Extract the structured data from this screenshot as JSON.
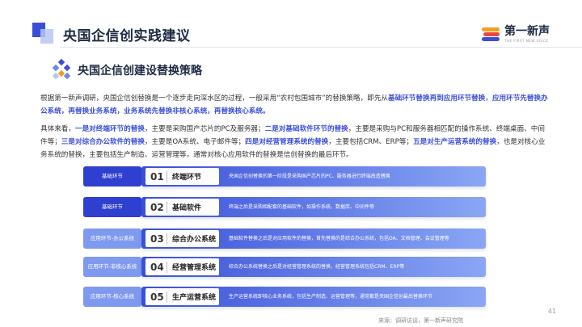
{
  "header": {
    "title": "央国企信创实践建议",
    "logo_text": "第一新声",
    "logo_sub": "THE FIRST NEW VOICE"
  },
  "section": {
    "title": "央国企信创建设替换策略"
  },
  "para1": {
    "t1": "根据第一新声调研，央国企信创替换是一个逐步走向深水区的过程，一般采用“农村包围城市”的替换策略，即先从",
    "h1": "基础环节替换再到应用环节替换",
    "t2": "，",
    "h2": "应用环节先替换办公系统，再替换业务系统，业务系统先替换非核心系统，再替换核心系统。"
  },
  "para2": {
    "t1": "具体来看，",
    "h1": "一是对终端环节的替换",
    "t2": "，主要是采购国产芯片的PC及服务器；",
    "h2": "二是对基础软件环节的替换",
    "t3": "，主要是采购与PC和服务器相匹配的操作系统、终端桌面、中间件等；",
    "h3": "三是对综合办公软件的替换",
    "t4": "，主要是OA系统、电子邮件等；",
    "h4": "四是对经营管理系统的替换",
    "t5": "，主要包括CRM、ERP等；",
    "h5": "五是对生产运营系统的替换",
    "t6": "，也是对核心业务系统的替换，主要包括生产制造、运营管理等，通常对核心应用软件的替换是信创替换的最后环节。"
  },
  "steps": [
    {
      "label": "基础环节",
      "num": "01",
      "name": "终端环节",
      "desc": "央国企信创替换的第一阶段是采购国产芯片的PC、服务器进行终端改造替换"
    },
    {
      "label": "基础环节",
      "num": "02",
      "name": "基础软件",
      "desc": "终端之后是采购相配套的基础软件，如操作系统、数据库、中间件等"
    },
    {
      "label": "应用环节-办公系统",
      "num": "03",
      "name": "综合办公系统",
      "desc": "基础软件替换之后是对应用软件的替换，首先替换的是综合办公系统，包括OA、文档管理、会议管理等"
    },
    {
      "label": "应用环节-非核心系统",
      "num": "04",
      "name": "经营管理系统",
      "desc": "综合办公系统替换之后是对经营管理系统的替换，经营管理系统包括CRM、ERP等"
    },
    {
      "label": "应用环节-核心系统",
      "num": "05",
      "name": "生产运营系统",
      "desc": "生产运营系统即核心业务系统，包括生产制造、运营管理等，通常都是央国企信创最后替换环节"
    }
  ],
  "colors": {
    "label_dark": "#2f3fcf",
    "band_dark": "#3a4fd8",
    "band_light": "#8aa6f4",
    "label_light": "#7f99ef"
  },
  "page_number": "41",
  "source": "来源：调研访谈，第一新声研究院"
}
